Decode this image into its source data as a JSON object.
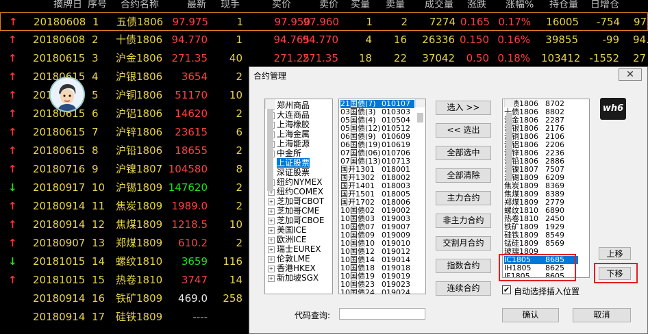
{
  "quote": {
    "headers": [
      "摘牌日",
      "序号",
      "合约名称",
      "最新",
      "现手",
      "买价",
      "卖价",
      "买量",
      "卖量",
      "成交量",
      "涨跌",
      "涨幅%",
      "持仓量",
      "日增仓"
    ],
    "rows": [
      {
        "dir": "up",
        "date": "20180608",
        "no": "1",
        "name": "五债1806",
        "last": "97.975",
        "vol": "1",
        "bid": "97.950",
        "ask": "97.960",
        "bq": "1",
        "aq": "2",
        "turn": "7274",
        "chg": "0.165",
        "pct": "0.17%",
        "oi": "16005",
        "inc": "-754",
        "extra": "97."
      },
      {
        "dir": "up",
        "date": "20180608",
        "no": "2",
        "name": "十债1806",
        "last": "94.770",
        "vol": "1",
        "bid": "94.765",
        "ask": "94.770",
        "bq": "4",
        "aq": "16",
        "turn": "26336",
        "chg": "0.150",
        "pct": "0.16%",
        "oi": "39855",
        "inc": "-99",
        "extra": "94."
      },
      {
        "dir": "up",
        "date": "20180615",
        "no": "3",
        "name": "沪金1806",
        "last": "271.35",
        "vol": "40",
        "bid": "271.25",
        "ask": "271.35",
        "bq": "18",
        "aq": "22",
        "turn": "37042",
        "chg": "0.50",
        "pct": "0.18%",
        "oi": "103412",
        "inc": "-1552",
        "extra": "27"
      },
      {
        "dir": "up",
        "date": "20180615",
        "no": "4",
        "name": "沪银1806",
        "last": "3654",
        "vol": "2"
      },
      {
        "dir": "up",
        "date": "20180615",
        "no": "5",
        "name": "沪铜1806",
        "last": "51170",
        "vol": "10"
      },
      {
        "dir": "up",
        "date": "20180615",
        "no": "6",
        "name": "沪铝1806",
        "last": "14620",
        "vol": "2"
      },
      {
        "dir": "up",
        "date": "20180615",
        "no": "7",
        "name": "沪锌1806",
        "last": "23615",
        "vol": "6"
      },
      {
        "dir": "up",
        "date": "20180615",
        "no": "8",
        "name": "沪铅1806",
        "last": "18655",
        "vol": "2"
      },
      {
        "dir": "up",
        "date": "20180716",
        "no": "9",
        "name": "沪镍1807",
        "last": "104580",
        "vol": "8"
      },
      {
        "dir": "down",
        "date": "20180917",
        "no": "10",
        "name": "沪锡1809",
        "last": "147620",
        "vol": "2"
      },
      {
        "dir": "up",
        "date": "20180914",
        "no": "11",
        "name": "焦炭1809",
        "last": "1989.0",
        "vol": "2"
      },
      {
        "dir": "up",
        "date": "20180914",
        "no": "12",
        "name": "焦煤1809",
        "last": "1218.5",
        "vol": "10"
      },
      {
        "dir": "up",
        "date": "20180907",
        "no": "13",
        "name": "郑煤1809",
        "last": "610.2",
        "vol": "2"
      },
      {
        "dir": "down",
        "date": "20181015",
        "no": "14",
        "name": "螺纹1810",
        "last": "3659",
        "vol": "116"
      },
      {
        "dir": "up",
        "date": "20181015",
        "no": "15",
        "name": "热卷1810",
        "last": "3747",
        "vol": "14"
      },
      {
        "dir": "none",
        "date": "20180914",
        "no": "16",
        "name": "铁矿1809",
        "last": "469.0",
        "vol": "258"
      },
      {
        "dir": "none",
        "date": "20180914",
        "no": "17",
        "name": "硅铁1809",
        "last": "----",
        "vol": ""
      }
    ]
  },
  "dialog": {
    "title": "合约管理",
    "close": "✕",
    "logo": "wh6",
    "exchanges": [
      "郑州商品",
      "大连商品",
      "上海橡胶",
      "上海金属",
      "上海能源",
      "中金所",
      "上证股票",
      "深证股票",
      "纽约NYMEX",
      "纽约COMEX",
      "芝加哥CBOT",
      "芝加哥CME",
      "芝加哥CBOE",
      "美国ICE",
      "欧洲ICE",
      "瑞士EUREX",
      "伦敦LME",
      "香港HKEX",
      "新加坡SGX"
    ],
    "selected_exchange": "上证股票",
    "contracts": [
      [
        "21国债(7)",
        "010107"
      ],
      [
        "03国债(3)",
        "010303"
      ],
      [
        "05国债(4)",
        "010504"
      ],
      [
        "05国债(12)",
        "010512"
      ],
      [
        "06国债(9)",
        "010609"
      ],
      [
        "06国债(19)",
        "010619"
      ],
      [
        "07国债(06)",
        "010706"
      ],
      [
        "07国债(13)",
        "010713"
      ],
      [
        "国开1301",
        "018001"
      ],
      [
        "国开1302",
        "018002"
      ],
      [
        "国开1401",
        "018003"
      ],
      [
        "国开1501",
        "018005"
      ],
      [
        "国开1702",
        "018006"
      ],
      [
        "10国债02",
        "019002"
      ],
      [
        "10国债03",
        "019003"
      ],
      [
        "10国债07",
        "019007"
      ],
      [
        "10国债09",
        "019009"
      ],
      [
        "10国债10",
        "019010"
      ],
      [
        "10国债12",
        "019012"
      ],
      [
        "10国债14",
        "019014"
      ],
      [
        "10国债18",
        "019018"
      ],
      [
        "10国债19",
        "019019"
      ],
      [
        "10国债23",
        "019023"
      ],
      [
        "10国债24",
        "019024"
      ]
    ],
    "buttons": {
      "add": "选入 >>",
      "remove": "<< 选出",
      "select_all": "全部选中",
      "clear_all": "全部清除",
      "main": "主力合约",
      "sub_main": "非主力合约",
      "delivery": "交割月合约",
      "index": "指数合约",
      "continuous": "连续合约",
      "up": "上移",
      "down": "下移",
      "ok": "确认",
      "cancel": "取消"
    },
    "selected_list": [
      [
        "五债1806",
        "8702"
      ],
      [
        "十债1806",
        "8802"
      ],
      [
        "沪金1806",
        "2287"
      ],
      [
        "沪银1806",
        "2176"
      ],
      [
        "沪铜1806",
        "2106"
      ],
      [
        "沪铝1806",
        "2206"
      ],
      [
        "沪锌1806",
        "2236"
      ],
      [
        "沪铅1806",
        "2886"
      ],
      [
        "沪镍1807",
        "7507"
      ],
      [
        "沪锡1809",
        "6209"
      ],
      [
        "焦炭1809",
        "8369"
      ],
      [
        "焦煤1809",
        "8389"
      ],
      [
        "郑煤1809",
        "2779"
      ],
      [
        "螺纹1810",
        "6890"
      ],
      [
        "热卷1810",
        "2450"
      ],
      [
        "铁矿1809",
        "1929"
      ],
      [
        "硅铁1809",
        "8549"
      ],
      [
        "锰硅1809",
        "8569"
      ],
      [
        "玻璃1809",
        ""
      ],
      [
        "IC1805",
        "8685"
      ],
      [
        "IH1805",
        "8625"
      ],
      [
        "IF1805",
        "8605"
      ]
    ],
    "auto_insert_label": "自动选择插入位置",
    "auto_insert_checked": true,
    "search_label": "代码查询:",
    "search_value": ""
  }
}
